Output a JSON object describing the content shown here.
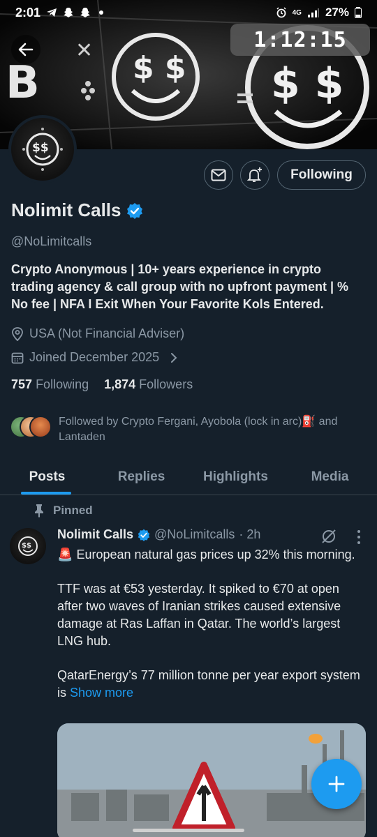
{
  "status_bar": {
    "time": "2:01",
    "network": "4G",
    "battery": "27%"
  },
  "timer": {
    "value": "1:12:15"
  },
  "banner": {
    "dollar_text": "$$"
  },
  "actions": {
    "follow_label": "Following"
  },
  "profile": {
    "name": "Nolimit Calls",
    "handle": "@NoLimitcalls",
    "bio": "Crypto Anonymous | 10+ years experience in crypto trading agency & call group with no upfront payment | % No fee | NFA I Exit When Your Favorite Kols Entered.",
    "location": "USA (Not Financial Adviser)",
    "joined": "Joined December 2025",
    "following_count": "757",
    "following_label": "Following",
    "followers_count": "1,874",
    "followers_label": "Followers",
    "followed_by": "Followed by Crypto Fergani, Ayobola (lock in arc)⛽ and Lantaden"
  },
  "tabs": [
    {
      "label": "Posts",
      "active": true
    },
    {
      "label": "Replies",
      "active": false
    },
    {
      "label": "Highlights",
      "active": false
    },
    {
      "label": "Media",
      "active": false
    }
  ],
  "post": {
    "pinned_label": "Pinned",
    "author": "Nolimit Calls",
    "handle": "@NoLimitcalls",
    "time": "· 2h",
    "alert_emoji": "🚨",
    "para1": "European natural gas prices up 32% this morning.",
    "para2": "TTF was at €53 yesterday. It spiked to €70 at open after two waves of Iranian strikes caused extensive damage at Ras Laffan in Qatar. The world’s largest LNG hub.",
    "para3": "QatarEnergy’s 77 million tonne per year export system is",
    "show_more": "Show more"
  },
  "colors": {
    "background": "#15202b",
    "accent": "#1d9bf0",
    "muted_text": "#8b98a5",
    "border": "#536471"
  }
}
